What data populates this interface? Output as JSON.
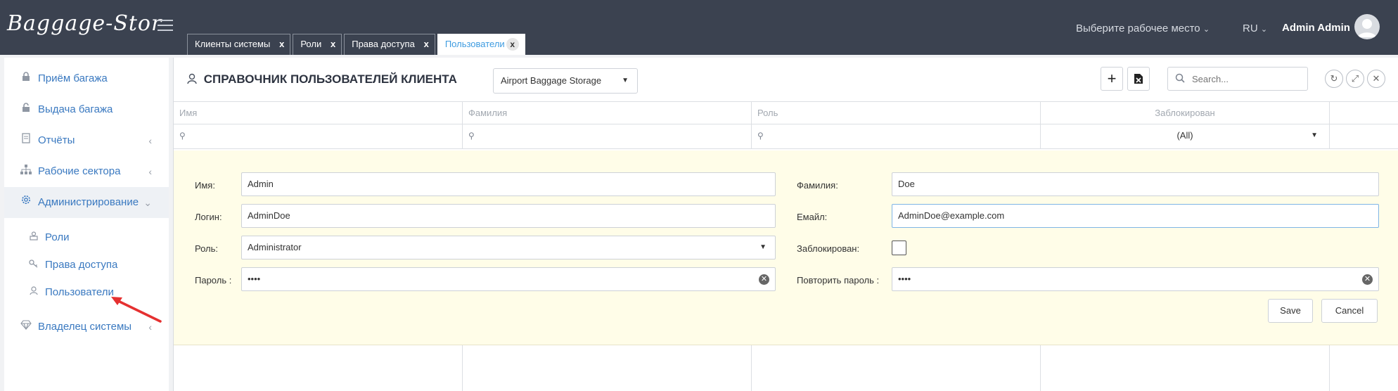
{
  "app": {
    "logo": "Baggage-Stor",
    "workspace": "Выберите рабочее место",
    "language": "RU",
    "user": "Admin Admin"
  },
  "tabs": [
    {
      "label": "Клиенты системы",
      "close": "x"
    },
    {
      "label": "Роли",
      "close": "x"
    },
    {
      "label": "Права доступа",
      "close": "x"
    },
    {
      "label": "Пользователи",
      "close": "x",
      "active": true
    }
  ],
  "sidebar": {
    "items": [
      {
        "label": "Приём багажа",
        "icon": "lock-icon"
      },
      {
        "label": "Выдача багажа",
        "icon": "unlock-icon"
      },
      {
        "label": "Отчёты",
        "icon": "document-icon"
      },
      {
        "label": "Рабочие сектора",
        "icon": "sitemap-icon"
      },
      {
        "label": "Администрирование",
        "icon": "gear-icon"
      },
      {
        "label": "Владелец системы",
        "icon": "diamond-icon"
      }
    ],
    "admin_sub": [
      {
        "label": "Роли",
        "icon": "roles-icon"
      },
      {
        "label": "Права доступа",
        "icon": "key-icon"
      },
      {
        "label": "Пользователи",
        "icon": "user-icon"
      }
    ]
  },
  "main": {
    "title": "СПРАВОЧНИК ПОЛЬЗОВАТЕЛЕЙ КЛИЕНТА",
    "client": "Airport Baggage Storage",
    "search_placeholder": "Search..."
  },
  "grid": {
    "columns": [
      "Имя",
      "Фамилия",
      "Роль",
      "Заблокирован"
    ],
    "filter_blocked": "(All)"
  },
  "form": {
    "first_name_label": "Имя:",
    "first_name": "Admin",
    "last_name_label": "Фамилия:",
    "last_name": "Doe",
    "login_label": "Логин:",
    "login": "AdminDoe",
    "email_label": "Емайл:",
    "email": "AdminDoe@example.com",
    "role_label": "Роль:",
    "role": "Administrator",
    "blocked_label": "Заблокирован:",
    "blocked": false,
    "password_label": "Пароль :",
    "password": "••••",
    "repeat_password_label": "Повторить пароль :",
    "repeat_password": "••••",
    "save": "Save",
    "cancel": "Cancel"
  },
  "colors": {
    "topbar": "#3b4250",
    "accent": "#3a79c0",
    "active_tab_text": "#3d9be0",
    "form_bg": "#fffde8",
    "annotation": "#e53030"
  }
}
